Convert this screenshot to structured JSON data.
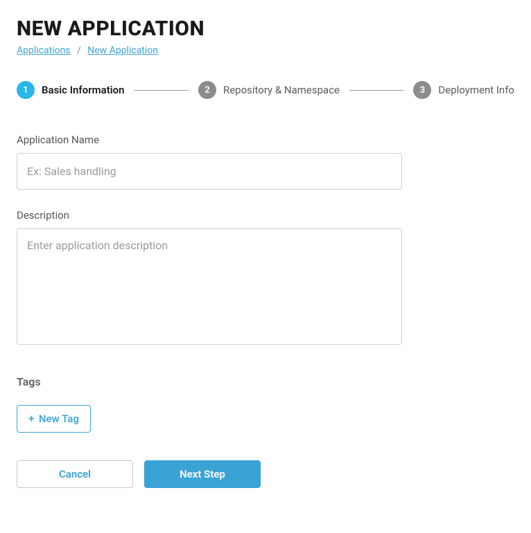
{
  "header": {
    "title": "NEW APPLICATION",
    "breadcrumb": {
      "items": [
        "Applications",
        "New Application"
      ],
      "separator": "/"
    }
  },
  "stepper": {
    "steps": [
      {
        "num": "1",
        "label": "Basic Information",
        "active": true
      },
      {
        "num": "2",
        "label": "Repository & Namespace",
        "active": false
      },
      {
        "num": "3",
        "label": "Deployment Info",
        "active": false
      }
    ]
  },
  "form": {
    "appName": {
      "label": "Application Name",
      "placeholder": "Ex: Sales handling",
      "value": ""
    },
    "description": {
      "label": "Description",
      "placeholder": "Enter application description",
      "value": ""
    },
    "tags": {
      "heading": "Tags",
      "newTagLabel": "New Tag"
    }
  },
  "actions": {
    "cancel": "Cancel",
    "next": "Next Step"
  }
}
